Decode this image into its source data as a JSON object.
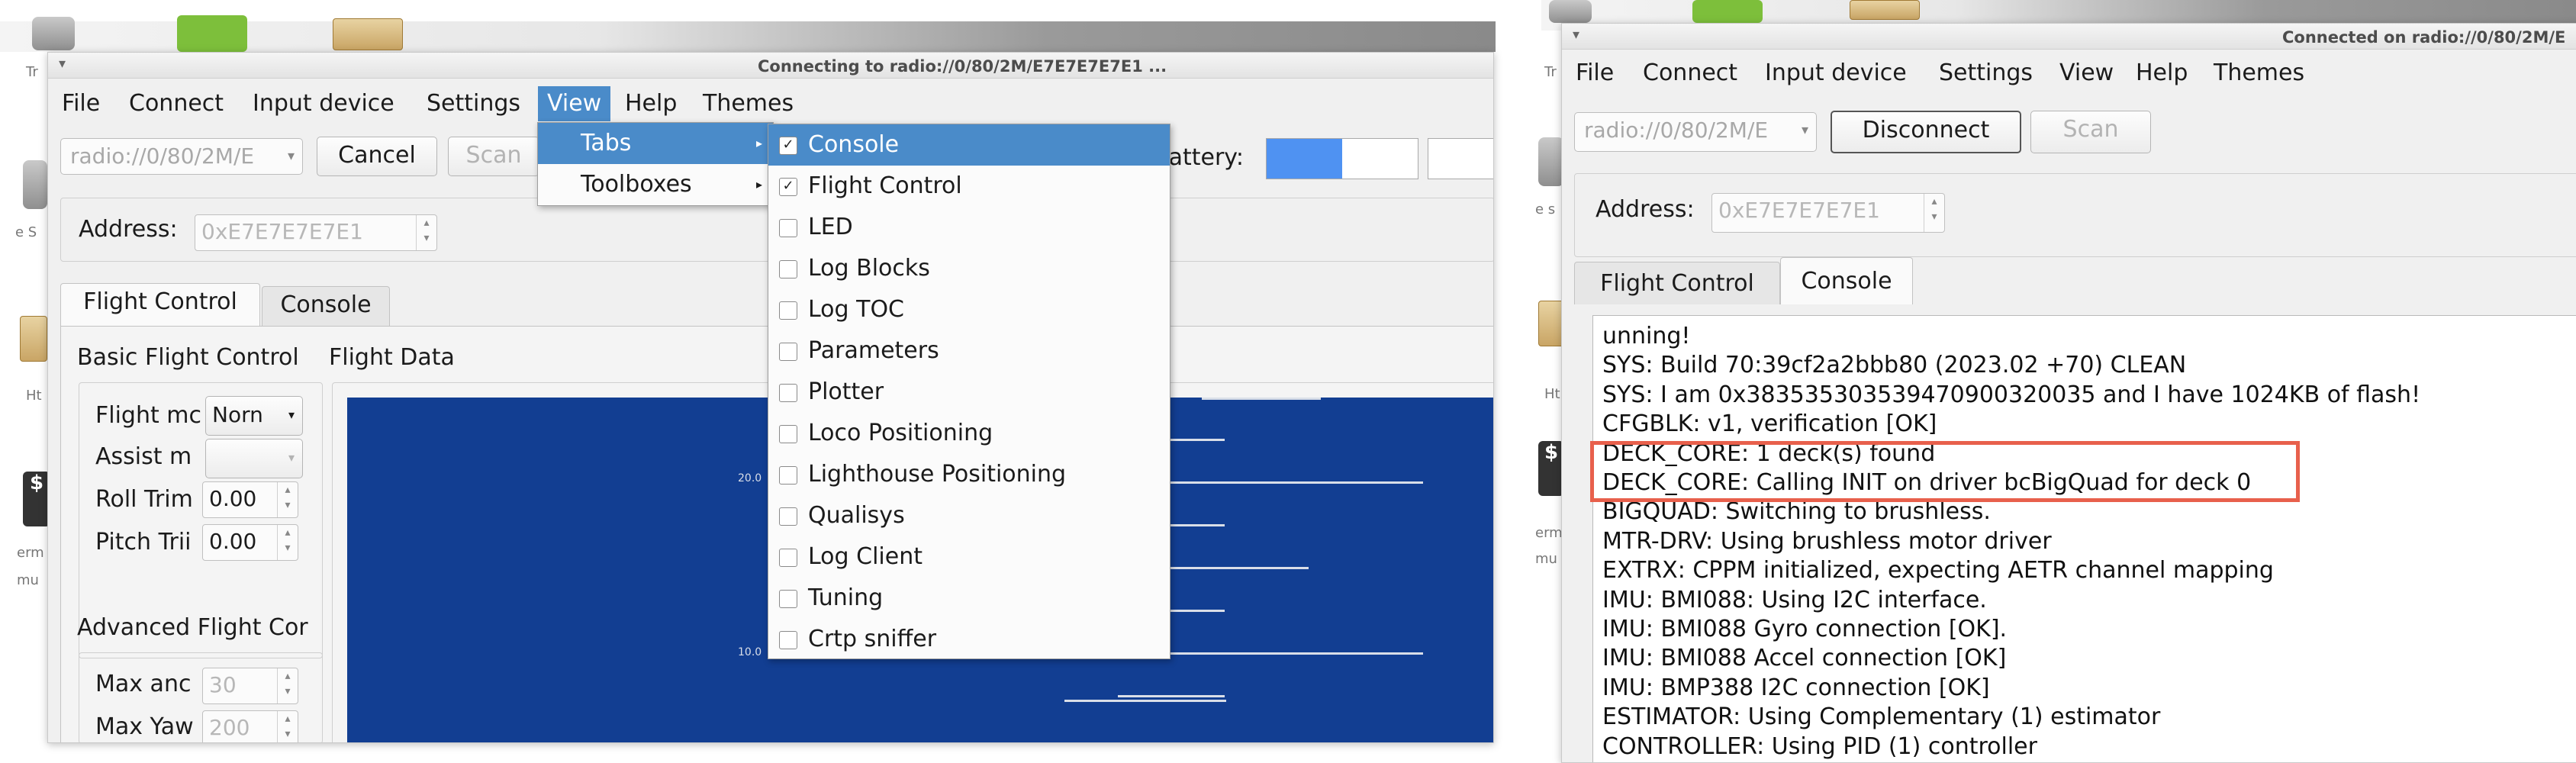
{
  "left_window": {
    "title": "Connecting to radio://0/80/2M/E7E7E7E7E1 ...",
    "menu": [
      "File",
      "Connect",
      "Input device",
      "Settings",
      "View",
      "Help",
      "Themes"
    ],
    "uri_value": "radio://0/80/2M/E",
    "cancel_label": "Cancel",
    "scan_label": "Scan",
    "battery_label": "Battery:",
    "battery_level": 0.5,
    "address_label": "Address:",
    "address_value": "0xE7E7E7E7E1",
    "tabs": [
      "Flight Control",
      "Console"
    ],
    "basic_title": "Basic Flight Control",
    "flight_data_title": "Flight Data",
    "flight_mode_label": "Flight mc",
    "flight_mode_value": "Norn",
    "assist_label": "Assist m",
    "roll_label": "Roll Trim",
    "roll_value": "0.00",
    "pitch_label": "Pitch Trii",
    "pitch_value": "0.00",
    "advanced_title": "Advanced Flight Cor",
    "max_angle_label": "Max anc",
    "max_angle_value": "30",
    "max_yaw_label": "Max Yaw",
    "max_yaw_value": "200",
    "plot_ticks": [
      "20.0",
      "10.0"
    ]
  },
  "view_menu": {
    "items": [
      {
        "label": "Tabs"
      },
      {
        "label": "Toolboxes"
      }
    ]
  },
  "tabs_submenu": {
    "items": [
      {
        "label": "Console",
        "checked": true
      },
      {
        "label": "Flight Control",
        "checked": true
      },
      {
        "label": "LED",
        "checked": false
      },
      {
        "label": "Log Blocks",
        "checked": false
      },
      {
        "label": "Log TOC",
        "checked": false
      },
      {
        "label": "Parameters",
        "checked": false
      },
      {
        "label": "Plotter",
        "checked": false
      },
      {
        "label": "Loco Positioning",
        "checked": false
      },
      {
        "label": "Lighthouse Positioning",
        "checked": false
      },
      {
        "label": "Qualisys",
        "checked": false
      },
      {
        "label": "Log Client",
        "checked": false
      },
      {
        "label": "Tuning",
        "checked": false
      },
      {
        "label": "Crtp sniffer",
        "checked": false
      }
    ]
  },
  "right_window": {
    "title": "Connected on radio://0/80/2M/E",
    "menu": [
      "File",
      "Connect",
      "Input device",
      "Settings",
      "View",
      "Help",
      "Themes"
    ],
    "uri_value": "radio://0/80/2M/E",
    "disconnect_label": "Disconnect",
    "scan_label": "Scan",
    "address_label": "Address:",
    "address_value": "0xE7E7E7E7E1",
    "tabs": [
      "Flight Control",
      "Console"
    ],
    "console_lines": [
      "unning!",
      "SYS: Build 70:39cf2a2bbb80 (2023.02 +70) CLEAN",
      "SYS: I am 0x38353530353947090032003​5 and I have 1024KB of flash!",
      "CFGBLK: v1, verification [OK]",
      "DECK_CORE: 1 deck(s) found",
      "DECK_CORE: Calling INIT on driver bcBigQuad for deck 0",
      "BIGQUAD: Switching to brushless.",
      "MTR-DRV: Using brushless motor driver",
      "EXTRX: CPPM initialized, expecting AETR channel mapping",
      "IMU: BMI088: Using I2C interface.",
      "IMU: BMI088 Gyro connection [OK].",
      "IMU: BMI088 Accel connection [OK]",
      "IMU: BMP388 I2C connection [OK]",
      "ESTIMATOR: Using Complementary (1) estimator",
      "CONTROLLER: Using PID (1) controller"
    ]
  },
  "desktop": {
    "labels": [
      "Tr",
      "e S",
      "Ht",
      "erm",
      "mu",
      "Tr",
      "e s",
      "Ht",
      "erm",
      "mu"
    ],
    "dollar": "$"
  },
  "colors": {
    "accent": "#4a8bc9",
    "plot_bg": "#123e92",
    "highlight": "#e8604c",
    "battery": "#4f92f2"
  }
}
